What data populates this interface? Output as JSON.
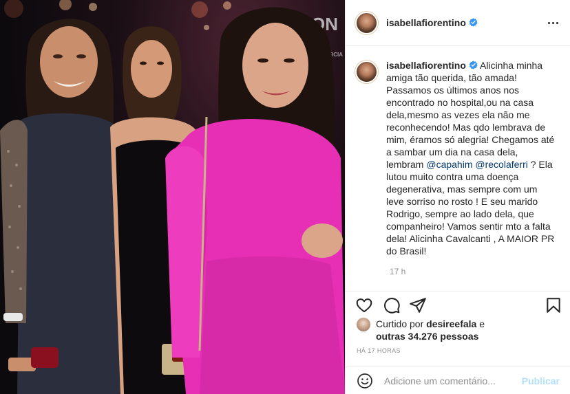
{
  "post": {
    "author": {
      "username": "isabellafiorentino",
      "verified": true
    },
    "menu_icon": "more-options-icon",
    "caption": {
      "username": "isabellafiorentino",
      "part1": " Alicinha minha amiga tão querida, tão amada! Passamos os últimos anos nos encontrado no hospital,ou na casa dela,mesmo as vezes ela não me reconhecendo! Mas qdo lembrava de mim, éramos só alegria! Chegamos até a sambar um dia na casa dela, lembram ",
      "mention1": "@capahim",
      "between": " ",
      "mention2": "@recolaferri",
      "part2": " ? Ela lutou muito contra uma doença degenerativa, mas sempre com um leve sorriso no rosto ! E seu marido Rodrigo, sempre ao lado dela, que companheiro! Vamos sentir mto a falta dela! Alicinha Cavalcanti , A MAIOR PR do Brasil!",
      "time": "17 h"
    },
    "actions": {
      "like_icon": "heart-icon",
      "comment_icon": "comment-icon",
      "share_icon": "share-icon",
      "save_icon": "bookmark-icon"
    },
    "likes": {
      "prefix": "Curtido por ",
      "liked_by": "desireefala",
      "middle": " e",
      "others": "outras 34.276 pessoas"
    },
    "timestamp": "HÁ 17 HORAS",
    "comment_box": {
      "emoji_icon": "emoji-icon",
      "placeholder": "Adicione um comentário...",
      "publish_label": "Publicar"
    }
  },
  "colors": {
    "text": "#262626",
    "muted": "#8e8e8e",
    "link": "#00376b",
    "publish_disabled": "#b2dffc",
    "verified_blue": "#3897f0",
    "dress_pink": "#e62fb5"
  }
}
